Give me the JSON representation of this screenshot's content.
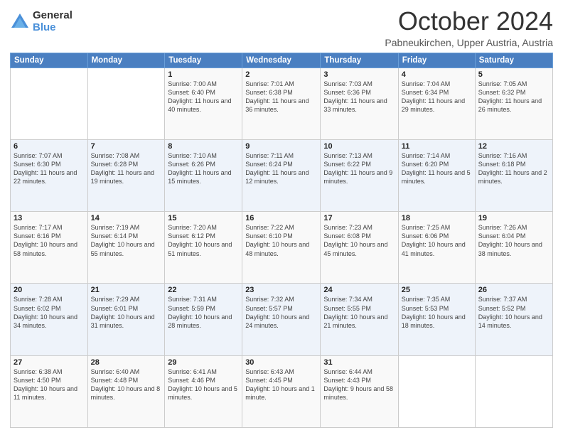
{
  "logo": {
    "general": "General",
    "blue": "Blue"
  },
  "header": {
    "month": "October 2024",
    "location": "Pabneukirchen, Upper Austria, Austria"
  },
  "weekdays": [
    "Sunday",
    "Monday",
    "Tuesday",
    "Wednesday",
    "Thursday",
    "Friday",
    "Saturday"
  ],
  "weeks": [
    [
      {
        "day": "",
        "sunrise": "",
        "sunset": "",
        "daylight": ""
      },
      {
        "day": "",
        "sunrise": "",
        "sunset": "",
        "daylight": ""
      },
      {
        "day": "1",
        "sunrise": "Sunrise: 7:00 AM",
        "sunset": "Sunset: 6:40 PM",
        "daylight": "Daylight: 11 hours and 40 minutes."
      },
      {
        "day": "2",
        "sunrise": "Sunrise: 7:01 AM",
        "sunset": "Sunset: 6:38 PM",
        "daylight": "Daylight: 11 hours and 36 minutes."
      },
      {
        "day": "3",
        "sunrise": "Sunrise: 7:03 AM",
        "sunset": "Sunset: 6:36 PM",
        "daylight": "Daylight: 11 hours and 33 minutes."
      },
      {
        "day": "4",
        "sunrise": "Sunrise: 7:04 AM",
        "sunset": "Sunset: 6:34 PM",
        "daylight": "Daylight: 11 hours and 29 minutes."
      },
      {
        "day": "5",
        "sunrise": "Sunrise: 7:05 AM",
        "sunset": "Sunset: 6:32 PM",
        "daylight": "Daylight: 11 hours and 26 minutes."
      }
    ],
    [
      {
        "day": "6",
        "sunrise": "Sunrise: 7:07 AM",
        "sunset": "Sunset: 6:30 PM",
        "daylight": "Daylight: 11 hours and 22 minutes."
      },
      {
        "day": "7",
        "sunrise": "Sunrise: 7:08 AM",
        "sunset": "Sunset: 6:28 PM",
        "daylight": "Daylight: 11 hours and 19 minutes."
      },
      {
        "day": "8",
        "sunrise": "Sunrise: 7:10 AM",
        "sunset": "Sunset: 6:26 PM",
        "daylight": "Daylight: 11 hours and 15 minutes."
      },
      {
        "day": "9",
        "sunrise": "Sunrise: 7:11 AM",
        "sunset": "Sunset: 6:24 PM",
        "daylight": "Daylight: 11 hours and 12 minutes."
      },
      {
        "day": "10",
        "sunrise": "Sunrise: 7:13 AM",
        "sunset": "Sunset: 6:22 PM",
        "daylight": "Daylight: 11 hours and 9 minutes."
      },
      {
        "day": "11",
        "sunrise": "Sunrise: 7:14 AM",
        "sunset": "Sunset: 6:20 PM",
        "daylight": "Daylight: 11 hours and 5 minutes."
      },
      {
        "day": "12",
        "sunrise": "Sunrise: 7:16 AM",
        "sunset": "Sunset: 6:18 PM",
        "daylight": "Daylight: 11 hours and 2 minutes."
      }
    ],
    [
      {
        "day": "13",
        "sunrise": "Sunrise: 7:17 AM",
        "sunset": "Sunset: 6:16 PM",
        "daylight": "Daylight: 10 hours and 58 minutes."
      },
      {
        "day": "14",
        "sunrise": "Sunrise: 7:19 AM",
        "sunset": "Sunset: 6:14 PM",
        "daylight": "Daylight: 10 hours and 55 minutes."
      },
      {
        "day": "15",
        "sunrise": "Sunrise: 7:20 AM",
        "sunset": "Sunset: 6:12 PM",
        "daylight": "Daylight: 10 hours and 51 minutes."
      },
      {
        "day": "16",
        "sunrise": "Sunrise: 7:22 AM",
        "sunset": "Sunset: 6:10 PM",
        "daylight": "Daylight: 10 hours and 48 minutes."
      },
      {
        "day": "17",
        "sunrise": "Sunrise: 7:23 AM",
        "sunset": "Sunset: 6:08 PM",
        "daylight": "Daylight: 10 hours and 45 minutes."
      },
      {
        "day": "18",
        "sunrise": "Sunrise: 7:25 AM",
        "sunset": "Sunset: 6:06 PM",
        "daylight": "Daylight: 10 hours and 41 minutes."
      },
      {
        "day": "19",
        "sunrise": "Sunrise: 7:26 AM",
        "sunset": "Sunset: 6:04 PM",
        "daylight": "Daylight: 10 hours and 38 minutes."
      }
    ],
    [
      {
        "day": "20",
        "sunrise": "Sunrise: 7:28 AM",
        "sunset": "Sunset: 6:02 PM",
        "daylight": "Daylight: 10 hours and 34 minutes."
      },
      {
        "day": "21",
        "sunrise": "Sunrise: 7:29 AM",
        "sunset": "Sunset: 6:01 PM",
        "daylight": "Daylight: 10 hours and 31 minutes."
      },
      {
        "day": "22",
        "sunrise": "Sunrise: 7:31 AM",
        "sunset": "Sunset: 5:59 PM",
        "daylight": "Daylight: 10 hours and 28 minutes."
      },
      {
        "day": "23",
        "sunrise": "Sunrise: 7:32 AM",
        "sunset": "Sunset: 5:57 PM",
        "daylight": "Daylight: 10 hours and 24 minutes."
      },
      {
        "day": "24",
        "sunrise": "Sunrise: 7:34 AM",
        "sunset": "Sunset: 5:55 PM",
        "daylight": "Daylight: 10 hours and 21 minutes."
      },
      {
        "day": "25",
        "sunrise": "Sunrise: 7:35 AM",
        "sunset": "Sunset: 5:53 PM",
        "daylight": "Daylight: 10 hours and 18 minutes."
      },
      {
        "day": "26",
        "sunrise": "Sunrise: 7:37 AM",
        "sunset": "Sunset: 5:52 PM",
        "daylight": "Daylight: 10 hours and 14 minutes."
      }
    ],
    [
      {
        "day": "27",
        "sunrise": "Sunrise: 6:38 AM",
        "sunset": "Sunset: 4:50 PM",
        "daylight": "Daylight: 10 hours and 11 minutes."
      },
      {
        "day": "28",
        "sunrise": "Sunrise: 6:40 AM",
        "sunset": "Sunset: 4:48 PM",
        "daylight": "Daylight: 10 hours and 8 minutes."
      },
      {
        "day": "29",
        "sunrise": "Sunrise: 6:41 AM",
        "sunset": "Sunset: 4:46 PM",
        "daylight": "Daylight: 10 hours and 5 minutes."
      },
      {
        "day": "30",
        "sunrise": "Sunrise: 6:43 AM",
        "sunset": "Sunset: 4:45 PM",
        "daylight": "Daylight: 10 hours and 1 minute."
      },
      {
        "day": "31",
        "sunrise": "Sunrise: 6:44 AM",
        "sunset": "Sunset: 4:43 PM",
        "daylight": "Daylight: 9 hours and 58 minutes."
      },
      {
        "day": "",
        "sunrise": "",
        "sunset": "",
        "daylight": ""
      },
      {
        "day": "",
        "sunrise": "",
        "sunset": "",
        "daylight": ""
      }
    ]
  ]
}
